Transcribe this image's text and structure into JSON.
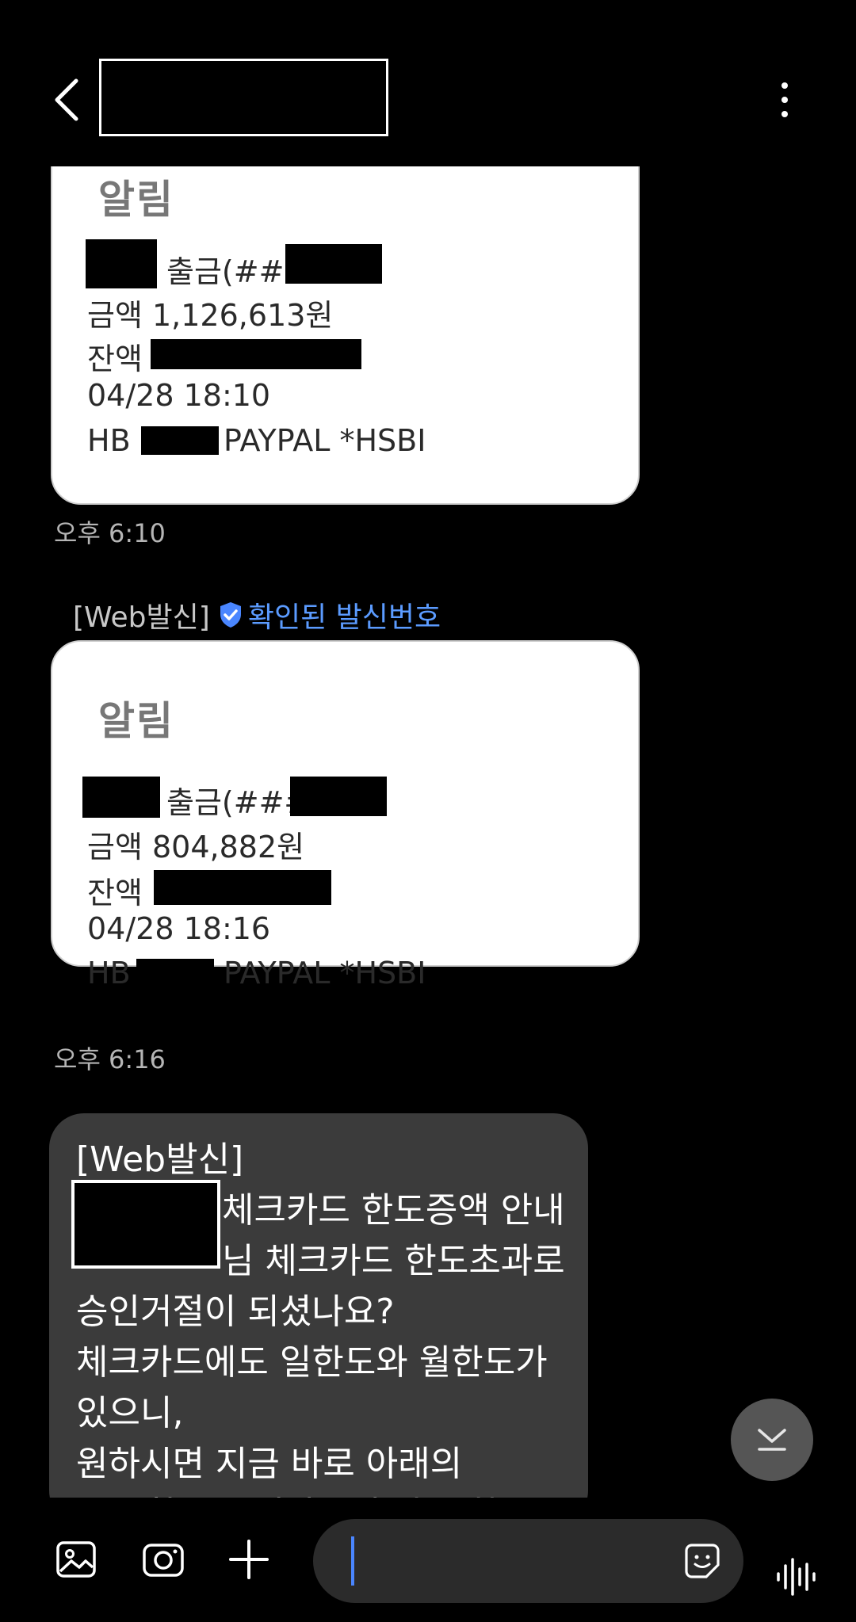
{
  "header": {
    "back_icon": "chevron-left-icon",
    "menu_icon": "kebab-menu-icon"
  },
  "messages": [
    {
      "notice_title": "알림",
      "withdraw_label": "출금(###",
      "amount_line": "금액 1,126,613원",
      "balance_label": "잔액",
      "datetime": "04/28 18:10",
      "merchant_prefix": "HB",
      "merchant": "PAYPAL *HSBI",
      "time": "오후 6:10"
    },
    {
      "sender_tag": "[Web발신]",
      "verified_label": "확인된 발신번호",
      "notice_title": "알림",
      "withdraw_label": "출금(###",
      "amount_line": "금액 804,882원",
      "balance_label": "잔액",
      "datetime": "04/28 18:16",
      "merchant_prefix": "HB",
      "merchant": "PAYPAL *HSBI",
      "time": "오후 6:16"
    },
    {
      "lines": [
        "[Web발신]",
        "체크카드 한도증액 안내",
        "님 체크카드 한도초과로",
        "승인거절이 되셨나요?",
        "체크카드에도 일한도와 월한도가",
        "있으니,",
        "원하시면 지금 바로 아래의",
        "URL창을 클릭하시어 카드 한도"
      ]
    }
  ],
  "composer": {
    "gallery_icon": "image-icon",
    "camera_icon": "camera-icon",
    "add_icon": "plus-icon",
    "sticker_icon": "sticker-icon",
    "voice_icon": "voice-wave-icon"
  },
  "colors": {
    "background": "#000000",
    "incoming_notice": "#ffffff",
    "incoming_dark": "#3b3b3b",
    "verified": "#5b9bff",
    "cursor": "#4a86ff"
  }
}
